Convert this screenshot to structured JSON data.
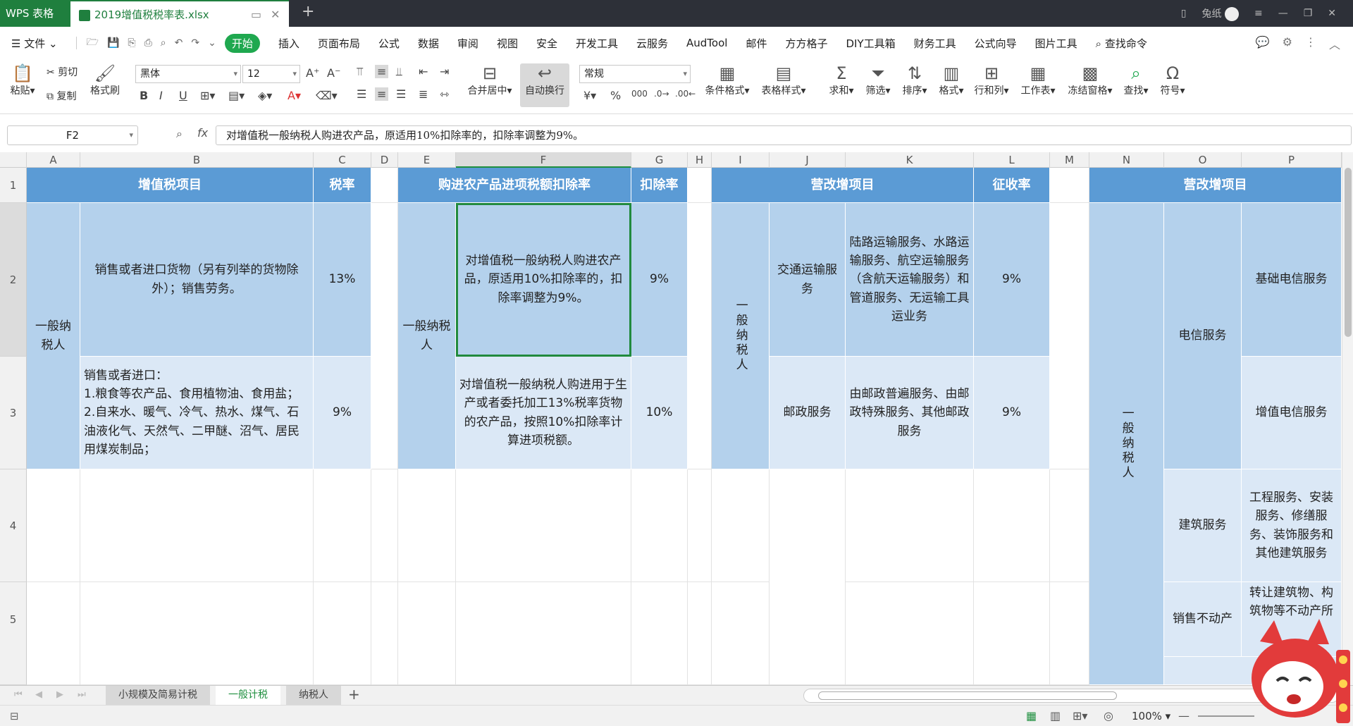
{
  "titlebar": {
    "app_name": "WPS 表格",
    "document_tab": "2019增值税税率表.xlsx",
    "user_name": "兔纸",
    "new_tab_symbol": "+"
  },
  "menu": {
    "file": "文件",
    "items": [
      "开始",
      "插入",
      "页面布局",
      "公式",
      "数据",
      "审阅",
      "视图",
      "安全",
      "开发工具",
      "云服务",
      "AudTool",
      "邮件",
      "方方格子",
      "DIY工具箱",
      "财务工具",
      "公式向导",
      "图片工具"
    ],
    "active": "开始",
    "search": "查找命令"
  },
  "ribbon": {
    "paste": "粘贴",
    "cut": "剪切",
    "copy": "复制",
    "format_painter": "格式刷",
    "font_name": "黑体",
    "font_size": "12",
    "merge_center": "合并居中",
    "wrap_text": "自动换行",
    "number_format": "常规",
    "conditional_format": "条件格式",
    "table_style": "表格样式",
    "sum": "求和",
    "filter": "筛选",
    "sort": "排序",
    "format": "格式",
    "row_col": "行和列",
    "worksheet": "工作表",
    "freeze": "冻结窗格",
    "find": "查找",
    "symbol": "符号"
  },
  "formula_bar": {
    "name_box": "F2",
    "fx": "fx",
    "content": "对增值税一般纳税人购进农产品，原适用10%扣除率的，扣除率调整为9%。"
  },
  "columns": [
    "A",
    "B",
    "C",
    "D",
    "E",
    "F",
    "G",
    "H",
    "I",
    "J",
    "K",
    "L",
    "M",
    "N",
    "O",
    "P"
  ],
  "rows": [
    "1",
    "2",
    "3",
    "4",
    "5"
  ],
  "cells": {
    "A1B1": "增值税项目",
    "C1": "税率",
    "E1F1": "购进农产品进项税额扣除率",
    "G1": "扣除率",
    "I1K1": "营改增项目",
    "L1": "征收率",
    "N1P1": "营改增项目",
    "A2A3": "一般纳税人",
    "B2": "销售或者进口货物（另有列举的货物除外）；销售劳务。",
    "C2": "13%",
    "B3": "销售或者进口：\n1.粮食等农产品、食用植物油、食用盐；\n2.自来水、暖气、冷气、热水、煤气、石油液化气、天然气、二甲醚、沼气、居民用煤炭制品；",
    "C3": "9%",
    "E2E3": "一般纳税人",
    "F2": "对增值税一般纳税人购进农产品，原适用10%扣除率的，扣除率调整为9%。",
    "G2": "9%",
    "F3": "对增值税一般纳税人购进用于生产或者委托加工13%税率货物的农产品，按照10%扣除率计算进项税额。",
    "G3": "10%",
    "I2I3": "一般纳税人",
    "J2": "交通运输服务",
    "K2": "陆路运输服务、水路运输服务、航空运输服务（含航天运输服务）和管道服务、无运输工具运业务",
    "L2": "9%",
    "J3": "邮政服务",
    "K3": "由邮政普遍服务、由邮政特殊服务、其他邮政服务",
    "L3": "9%",
    "N2N5": "一般纳税人",
    "O2O3": "电信服务",
    "P2": "基础电信服务",
    "P3": "增值电信服务",
    "O4": "建筑服务",
    "P4": "工程服务、安装服务、修缮服务、装饰服务和其他建筑服务",
    "O5": "销售不动产",
    "P5": "转让建筑物、构筑物等不动产所"
  },
  "sheets": [
    "小规模及简易计税",
    "一般计税",
    "纳税人"
  ],
  "active_sheet": "一般计税",
  "status": {
    "zoom": "100%"
  },
  "colors": {
    "header_fill": "#5b9bd5",
    "level1_fill": "#b4d1ec",
    "level2_fill": "#dbe8f6",
    "accent_green": "#1fa84f"
  }
}
